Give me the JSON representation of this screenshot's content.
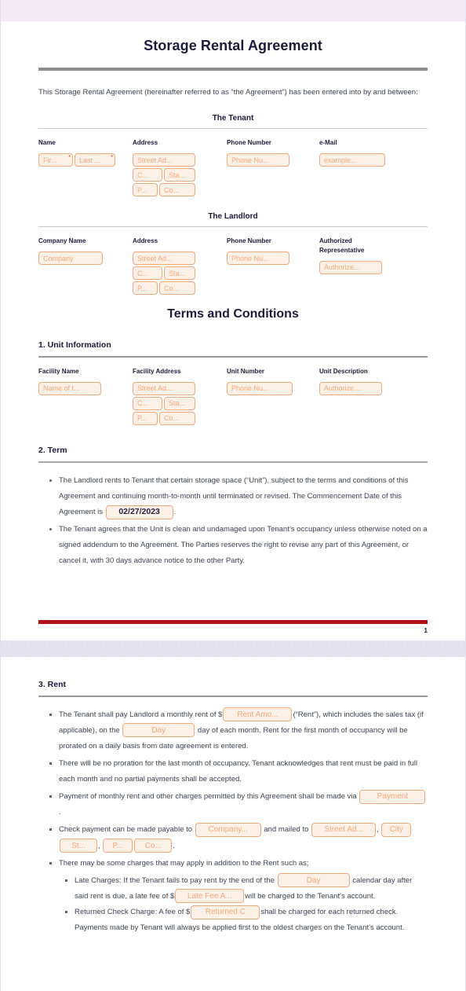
{
  "document": {
    "title": "Storage Rental Agreement",
    "intro": "This Storage Rental Agreement (hereinafter referred to as “the Agreement”) has been entered into by and between:",
    "terms_title": "Terms and Conditions",
    "page_number": "1"
  },
  "tenant": {
    "heading": "The Tenant",
    "labels": {
      "name": "Name",
      "address": "Address",
      "phone": "Phone Number",
      "email": "e-Mail"
    },
    "fields": {
      "first_name": "Fir...",
      "last_name": "Last ...",
      "street": "Street Ad...",
      "city": "C...",
      "state": "Sta...",
      "postal": "P...",
      "country": "Co...",
      "phone": "Phone Nu...",
      "email": "example...",
      "required_mark": "*"
    }
  },
  "landlord": {
    "heading": "The Landlord",
    "labels": {
      "company": "Company Name",
      "address": "Address",
      "phone": "Phone Number",
      "authorized_rep_line1": "Authorized",
      "authorized_rep_line2": "Representative"
    },
    "fields": {
      "company": "Company",
      "street": "Street Ad...",
      "city": "C...",
      "state": "Sta...",
      "postal": "P...",
      "country": "Co...",
      "phone": "Phone Nu...",
      "authorized_rep": "Authorize..."
    }
  },
  "unit_information": {
    "heading": "1. Unit Information",
    "labels": {
      "facility_name": "Facility Name",
      "facility_address": "Facility Address",
      "unit_number": "Unit Number",
      "unit_description": "Unit Description"
    },
    "fields": {
      "facility_name": "Name of t...",
      "street": "Street Ad...",
      "city": "C...",
      "state": "Sta...",
      "postal": "P...",
      "country": "Co...",
      "unit_number": "Phone Nu...",
      "unit_description": "Authorize..."
    }
  },
  "term": {
    "heading": "2. Term",
    "bullet1_part1": "The Landlord rents to Tenant that certain storage space (“Unit”), subject to the terms and conditions of this Agreement and continuing month-to-month until terminated or revised. The Commencement Date of this Agreement is",
    "commencement_date": "02/27/2023",
    "bullet1_part2": ".",
    "bullet2": "The Tenant agrees that the Unit is clean and undamaged upon Tenant’s occupancy unless otherwise noted on a signed addendum to the Agreement. The Parties reserves the right to revise any part of this Agreement, or cancel it, with 30 days advance notice to the other Party."
  },
  "rent": {
    "heading": "3. Rent",
    "b1_p1": "The Tenant shall pay Landlord a monthly rent of $",
    "rent_amount": "Rent Amo...",
    "b1_p2": "(“Rent”), which includes the sales tax (if applicable), on the",
    "day": "Day",
    "b1_p3": "day of each month. Rent for the first month of occupancy will be prorated on a daily basis from date agreement is entered.",
    "b2": "There will be no proration for the last month of occupancy. Tenant acknowledges that rent must be paid in full each month and no partial payments shall be accepted.",
    "b3_p1": "Payment of monthly rent and other charges permitted by this Agreement shall be made via",
    "payment_method": "Payment",
    "b3_p2": ".",
    "b4_p1": "Check payment can be made payable to",
    "payable_company": "Company...",
    "b4_p2": "and mailed to",
    "mail_street": "Street Ad...",
    "b4_p3": ",",
    "mail_city": "City",
    "mail_state": "St...",
    "b4_p4": ",",
    "mail_postal": "P...",
    "mail_country": "Co...",
    "b4_p5": ".",
    "b5": "There may be some charges that may apply in addition to the Rent such as;",
    "late_p1": "Late Charges: If the Tenant fails to pay rent by the end of the",
    "late_day": "Day",
    "late_p2": "calendar day after said rent is due, a late fee of $",
    "late_fee": "Late Fee A...",
    "late_p3": "will be charged to the Tenant’s account.",
    "ret_p1": "Returned Check Charge: A fee of $",
    "returned_fee": "Returned C",
    "ret_p2": "shall be charged for each returned check. Payments made by Tenant will always be applied first to the oldest charges on the Tenant’s account."
  },
  "colors": {
    "topbar": "#f6e9f7",
    "gap": "#e4e3f2",
    "chip_bg": "#fdf0e7",
    "chip_border": "#f2a97a",
    "chip_text": "#f3a97c",
    "heading": "#1c1b3a",
    "body_text": "#3c4352",
    "footer_rule": "#b21117",
    "required": "#c0392b"
  }
}
